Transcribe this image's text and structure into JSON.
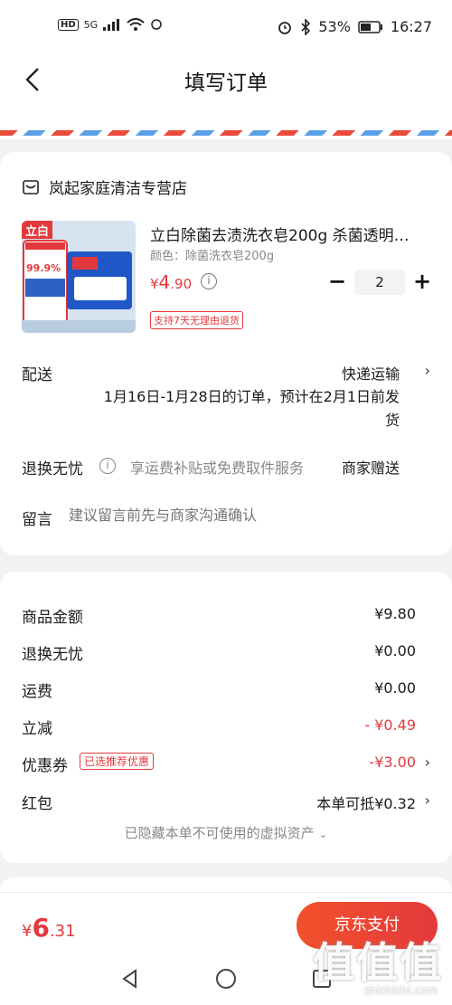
{
  "status_bar": {
    "network": "5G",
    "battery": "53%",
    "time": "16:27"
  },
  "header": {
    "title": "填写订单"
  },
  "store": {
    "name": "岚起家庭清洁专营店"
  },
  "product": {
    "title": "立白除菌去渍洗衣皂200g 杀菌透明…",
    "variant": "颜色：除菌洗衣皂200g",
    "price_symbol": "¥",
    "price_int": "4",
    "price_dec": ".90",
    "quantity": "2",
    "return_badge": "支持7天无理由退货",
    "image_brand": "立白",
    "image_percent": "99.9%"
  },
  "shipping": {
    "label": "配送",
    "method": "快递运输",
    "note": "1月16日-1月28日的订单，预计在2月1日前发货"
  },
  "return_service": {
    "label": "退换无忧",
    "desc": "享运费补贴或免费取件服务",
    "gift": "商家赠送"
  },
  "message": {
    "label": "留言",
    "placeholder": "建议留言前先与商家沟通确认"
  },
  "summary": {
    "goods_label": "商品金额",
    "goods_value": "¥9.80",
    "return_label": "退换无忧",
    "return_value": "¥0.00",
    "freight_label": "运费",
    "freight_value": "¥0.00",
    "discount_label": "立减",
    "discount_value": "- ¥0.49",
    "coupon_label": "优惠券",
    "coupon_tag": "已选推荐优惠",
    "coupon_value": "-¥3.00",
    "redpacket_label": "红包",
    "redpacket_value": "本单可抵¥0.32",
    "hidden_note": "已隐藏本单不可使用的虚拟资产"
  },
  "pay_bar": {
    "total_symbol": "¥",
    "total_int": "6",
    "total_dec": ".31",
    "pay_label": "京东支付"
  },
  "watermark": {
    "text": "值值值",
    "site": "zhizhizhi.com"
  },
  "colors": {
    "accent": "#e4393c",
    "muted": "#888888"
  }
}
